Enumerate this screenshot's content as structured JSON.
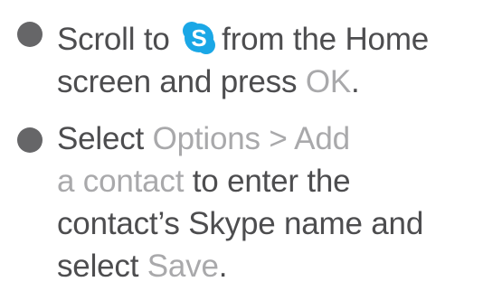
{
  "steps": [
    {
      "line1_a": "Scroll to",
      "icon": "skype-icon",
      "line1_b": "from the Home",
      "line2_a": "screen and press ",
      "ok": "OK",
      "period": "."
    },
    {
      "select": "Select ",
      "options_add": "Options > Add",
      "a_contact": "a contact",
      "to_enter": " to enter the",
      "line3": "contact’s Skype name and",
      "select2": "select ",
      "save": "Save",
      "period": "."
    }
  ],
  "colors": {
    "text": "#4d4d4f",
    "menu_highlight": "#a9a9ab",
    "bullet": "#666668",
    "skype_blue": "#1aa7e6"
  }
}
